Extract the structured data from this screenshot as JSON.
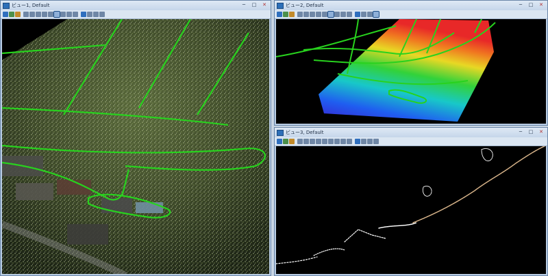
{
  "windows": [
    {
      "title": "ビュー1, Default"
    },
    {
      "title": "ビュー2, Default"
    },
    {
      "title": "ビュー3, Default"
    }
  ],
  "controls": {
    "minimize": "─",
    "maximize": "□",
    "close": "✕"
  },
  "colors": {
    "contour": "#28d21e",
    "titlebar": "#c5d6ea",
    "background": "#000000"
  }
}
